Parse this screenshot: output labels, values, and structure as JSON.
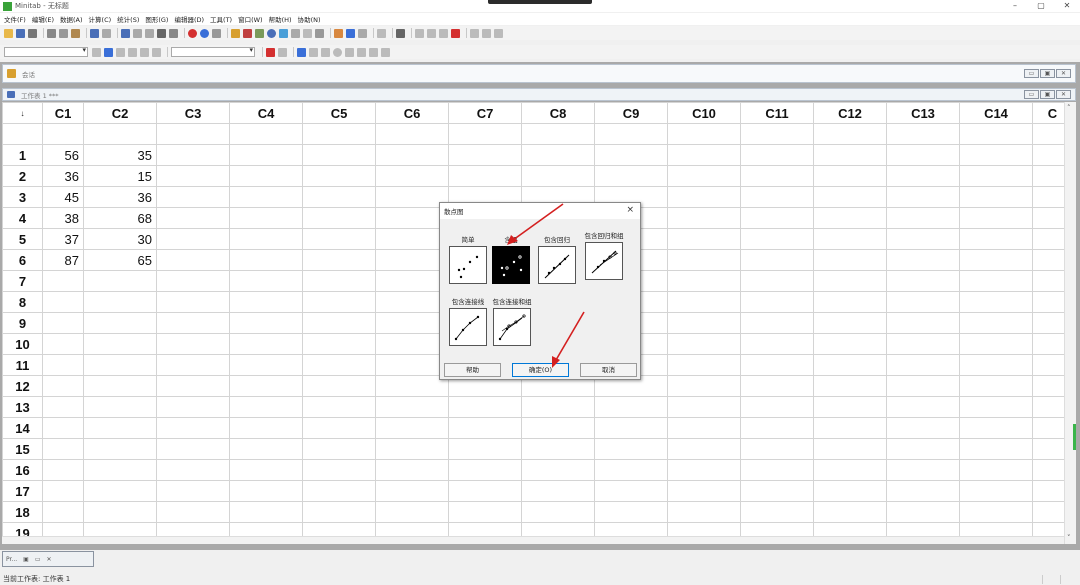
{
  "window": {
    "title": "Minitab - 无标题"
  },
  "menu": {
    "items": [
      "文件(F)",
      "编辑(E)",
      "数据(A)",
      "计算(C)",
      "统计(S)",
      "图形(G)",
      "编辑器(D)",
      "工具(T)",
      "窗口(W)",
      "帮助(H)",
      "协助(N)"
    ]
  },
  "session": {
    "label": "会话"
  },
  "worksheet": {
    "title": "工作表 1 ***",
    "corner_symbol": "↓",
    "columns": [
      "C1",
      "C2",
      "C3",
      "C4",
      "C5",
      "C6",
      "C7",
      "C8",
      "C9",
      "C10",
      "C11",
      "C12",
      "C13",
      "C14",
      "C"
    ],
    "rows": [
      {
        "n": "1",
        "c1": "56",
        "c2": "35"
      },
      {
        "n": "2",
        "c1": "36",
        "c2": "15"
      },
      {
        "n": "3",
        "c1": "45",
        "c2": "36"
      },
      {
        "n": "4",
        "c1": "38",
        "c2": "68"
      },
      {
        "n": "5",
        "c1": "37",
        "c2": "30"
      },
      {
        "n": "6",
        "c1": "87",
        "c2": "65"
      },
      {
        "n": "7",
        "c1": "",
        "c2": ""
      },
      {
        "n": "8",
        "c1": "",
        "c2": ""
      },
      {
        "n": "9",
        "c1": "",
        "c2": ""
      },
      {
        "n": "10",
        "c1": "",
        "c2": ""
      },
      {
        "n": "11",
        "c1": "",
        "c2": ""
      },
      {
        "n": "12",
        "c1": "",
        "c2": ""
      },
      {
        "n": "13",
        "c1": "",
        "c2": ""
      },
      {
        "n": "14",
        "c1": "",
        "c2": ""
      },
      {
        "n": "15",
        "c1": "",
        "c2": ""
      },
      {
        "n": "16",
        "c1": "",
        "c2": ""
      },
      {
        "n": "17",
        "c1": "",
        "c2": ""
      },
      {
        "n": "18",
        "c1": "",
        "c2": ""
      },
      {
        "n": "19",
        "c1": "",
        "c2": ""
      }
    ]
  },
  "dialog": {
    "title": "散点图",
    "close": "×",
    "options": [
      "简单",
      "含组",
      "包含回归",
      "包含回归和组",
      "包含连接线",
      "包含连接和组"
    ],
    "selected": "含组",
    "buttons": {
      "help": "帮助",
      "ok": "确定(O)",
      "cancel": "取消"
    }
  },
  "taskbar": {
    "label": "Pr..."
  },
  "status": {
    "text": "当前工作表: 工作表 1"
  },
  "colors": {
    "accent_red": "#d42020",
    "selected_thumb": "#000000",
    "scroll_marker": "#3ab54a"
  }
}
